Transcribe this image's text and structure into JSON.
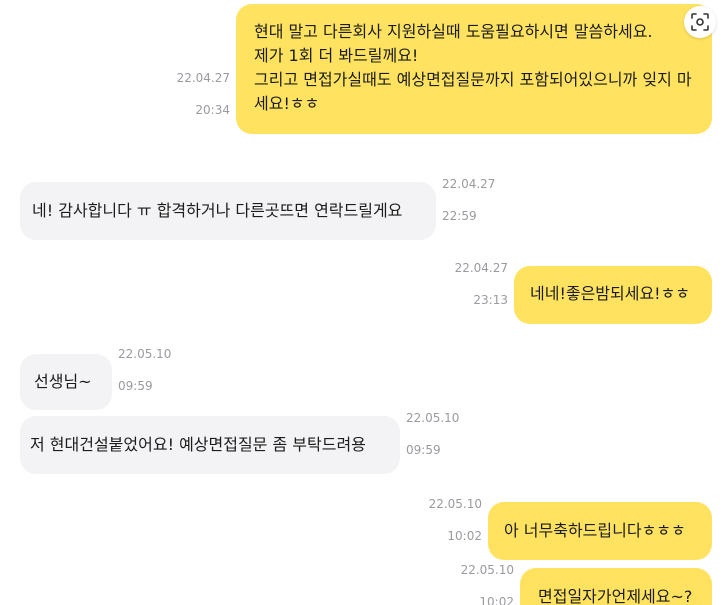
{
  "messages": [
    {
      "side": "mine",
      "text": "현대 말고 다른회사 지원하실때 도움필요하시면 말씀하세요.\n제가 1회 더 봐드릴께요!\n그리고 면접가실때도 예상면접질문까지 포함되어있으니까 잊지 마세요!ㅎㅎ",
      "date": "22.04.27",
      "time": "20:34"
    },
    {
      "side": "theirs",
      "text": "네! 감사합니다 ㅠ 합격하거나 다른곳뜨면 연락드릴게요",
      "date": "22.04.27",
      "time": "22:59"
    },
    {
      "side": "mine",
      "text": "네네!좋은밤되세요!ㅎㅎ",
      "date": "22.04.27",
      "time": "23:13"
    },
    {
      "side": "theirs",
      "text": "선생님~",
      "date": "22.05.10",
      "time": "09:59"
    },
    {
      "side": "theirs",
      "text": "저 현대건설붙었어요! 예상면접질문 좀 부탁드려용",
      "date": "22.05.10",
      "time": "09:59"
    },
    {
      "side": "mine",
      "text": "아 너무축하드립니다ㅎㅎㅎ",
      "date": "22.05.10",
      "time": "10:02"
    },
    {
      "side": "mine",
      "text": "면접일자가언제세요~?",
      "date": "22.05.10",
      "time": "10:02"
    }
  ],
  "icons": {
    "scan": "scan-text-icon"
  },
  "colors": {
    "mine_bubble": "#ffe360",
    "theirs_bubble": "#f3f3f5",
    "timestamp": "#9a9aa0"
  }
}
